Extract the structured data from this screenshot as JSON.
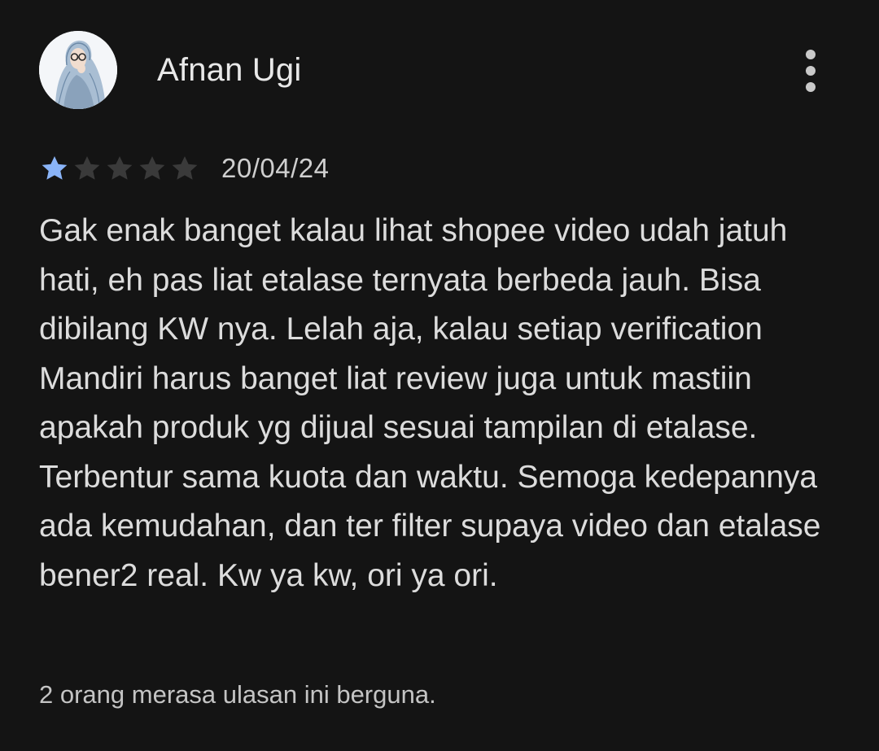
{
  "review": {
    "author": "Afnan Ugi",
    "rating": 1,
    "max_rating": 5,
    "date": "20/04/24",
    "text": "Gak enak banget kalau lihat shopee video udah jatuh hati, eh pas liat etalase ternyata berbeda jauh. Bisa dibilang KW nya. Lelah aja, kalau setiap verification Mandiri harus banget liat review juga untuk mastiin apakah produk yg dijual sesuai tampilan di etalase. Terbentur sama kuota dan waktu. Semoga kedepannya ada kemudahan, dan ter filter supaya video dan etalase bener2 real. Kw ya kw, ori ya ori.",
    "helpful": "2 orang merasa ulasan ini berguna."
  },
  "icons": {
    "more": "more-vert-icon",
    "star": "star-icon"
  },
  "colors": {
    "background": "#141414",
    "star_filled": "#8ab4f8",
    "star_empty": "#3a3a3a",
    "text": "#dcdcdc"
  }
}
